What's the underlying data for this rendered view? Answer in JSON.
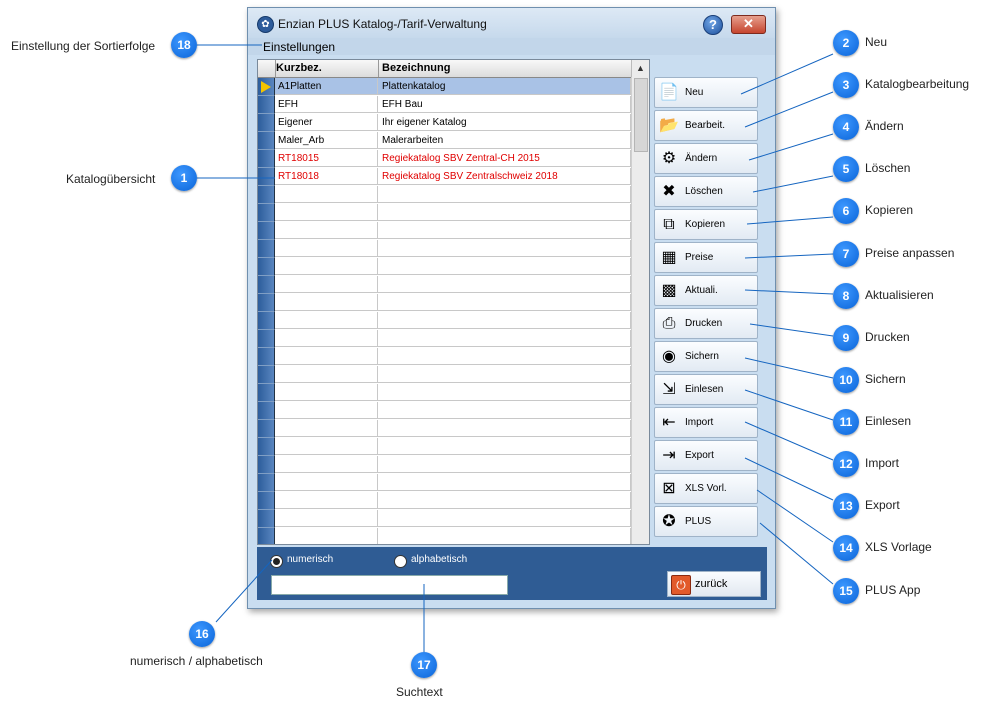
{
  "window": {
    "title": "Enzian PLUS Katalog-/Tarif-Verwaltung",
    "help_label": "?",
    "close_label": "✕",
    "menu": "Einstellungen"
  },
  "grid": {
    "headers": [
      "Kurzbez.",
      "Bezeichnung"
    ],
    "rows": [
      {
        "code": "A1Platten",
        "name": "Plattenkatalog",
        "color": "#000000",
        "selected": true
      },
      {
        "code": "EFH",
        "name": "EFH Bau",
        "color": "#000000"
      },
      {
        "code": "Eigener",
        "name": "Ihr eigener Katalog",
        "color": "#000000"
      },
      {
        "code": "Maler_Arb",
        "name": "Malerarbeiten",
        "color": "#000000"
      },
      {
        "code": "RT18015",
        "name": "Regiekatalog SBV Zentral-CH 2015",
        "color": "#e00000"
      },
      {
        "code": "RT18018",
        "name": "Regiekatalog SBV Zentralschweiz 2018",
        "color": "#e00000"
      }
    ],
    "empty_rows": 20
  },
  "buttons": [
    {
      "name": "new-button",
      "label": "Neu",
      "icon": "document-icon",
      "glyph": "📄"
    },
    {
      "name": "edit-button",
      "label": "Bearbeit.",
      "icon": "folder-icon",
      "glyph": "📂"
    },
    {
      "name": "change-button",
      "label": "Ändern",
      "icon": "gear-icon",
      "glyph": "⚙"
    },
    {
      "name": "delete-button",
      "label": "Löschen",
      "icon": "x-icon",
      "glyph": "✖"
    },
    {
      "name": "copy-button",
      "label": "Kopieren",
      "icon": "copy-icon",
      "glyph": "⧉"
    },
    {
      "name": "prices-button",
      "label": "Preise",
      "icon": "calculator-icon",
      "glyph": "▦"
    },
    {
      "name": "update-button",
      "label": "Aktuali.",
      "icon": "blocks-icon",
      "glyph": "▩"
    },
    {
      "name": "print-button",
      "label": "Drucken",
      "icon": "printer-icon",
      "glyph": "⎙"
    },
    {
      "name": "save-button",
      "label": "Sichern",
      "icon": "disc-icon",
      "glyph": "◉"
    },
    {
      "name": "read-in-button",
      "label": "Einlesen",
      "icon": "load-icon",
      "glyph": "⇲"
    },
    {
      "name": "import-button",
      "label": "Import",
      "icon": "import-icon",
      "glyph": "⇤"
    },
    {
      "name": "export-button",
      "label": "Export",
      "icon": "export-icon",
      "glyph": "⇥"
    },
    {
      "name": "xls-template-button",
      "label": "XLS Vorl.",
      "icon": "excel-icon",
      "glyph": "⊠"
    },
    {
      "name": "plus-app-button",
      "label": "PLUS",
      "icon": "app-icon",
      "glyph": "✪"
    }
  ],
  "bottom": {
    "radio_numeric": "numerisch",
    "radio_alpha": "alphabetisch",
    "search_value": "",
    "back_label": "zurück"
  },
  "annotations": [
    {
      "num": "1",
      "label": "Katalogübersicht"
    },
    {
      "num": "2",
      "label": "Neu"
    },
    {
      "num": "3",
      "label": "Katalogbearbeitung"
    },
    {
      "num": "4",
      "label": "Ändern"
    },
    {
      "num": "5",
      "label": "Löschen"
    },
    {
      "num": "6",
      "label": "Kopieren"
    },
    {
      "num": "7",
      "label": "Preise anpassen"
    },
    {
      "num": "8",
      "label": "Aktualisieren"
    },
    {
      "num": "9",
      "label": "Drucken"
    },
    {
      "num": "10",
      "label": "Sichern"
    },
    {
      "num": "11",
      "label": "Einlesen"
    },
    {
      "num": "12",
      "label": "Import"
    },
    {
      "num": "13",
      "label": "Export"
    },
    {
      "num": "14",
      "label": "XLS Vorlage"
    },
    {
      "num": "15",
      "label": "PLUS App"
    },
    {
      "num": "16",
      "label": "numerisch / alphabetisch"
    },
    {
      "num": "17",
      "label": "Suchtext"
    },
    {
      "num": "18",
      "label": "Einstellung der Sortierfolge"
    }
  ],
  "colors": {
    "annotation": "#0a64d8",
    "window_bg": "#c9ddf0",
    "bottom_panel": "#2f5c94",
    "red_text": "#e00000"
  }
}
